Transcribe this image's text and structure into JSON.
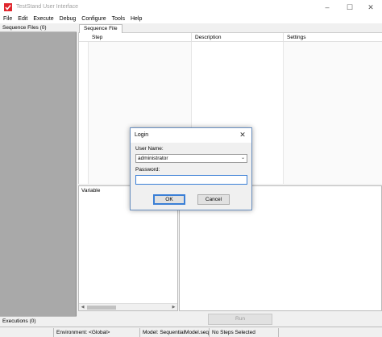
{
  "window": {
    "title": "TestStand User Interface",
    "controls": {
      "minimize": "–",
      "maximize": "☐",
      "close": "✕"
    },
    "icon": "teststand-logo-icon",
    "accent": "#e0262d"
  },
  "menu": [
    "File",
    "Edit",
    "Execute",
    "Debug",
    "Configure",
    "Tools",
    "Help"
  ],
  "left_panel": {
    "header": "Sequence Files (0)",
    "footer": "Executions (0)"
  },
  "tabs": [
    {
      "label": "Sequence File"
    }
  ],
  "sequence_grid": {
    "columns": [
      "Step",
      "Description",
      "Settings"
    ]
  },
  "variables_panel": {
    "header": "Variable",
    "scroll_left": "◀",
    "scroll_right": "▶"
  },
  "run_button": "Run",
  "status": {
    "environment": "Environment: <Global>",
    "model": "Model: SequentialModel.seq",
    "steps": "No Steps Selected"
  },
  "login_dialog": {
    "title": "Login",
    "close": "✕",
    "user_name_label": "User Name:",
    "user_name_value": "administrator",
    "caret": "⌄",
    "password_label": "Password:",
    "password_value": "",
    "ok_label": "OK",
    "cancel_label": "Cancel"
  }
}
